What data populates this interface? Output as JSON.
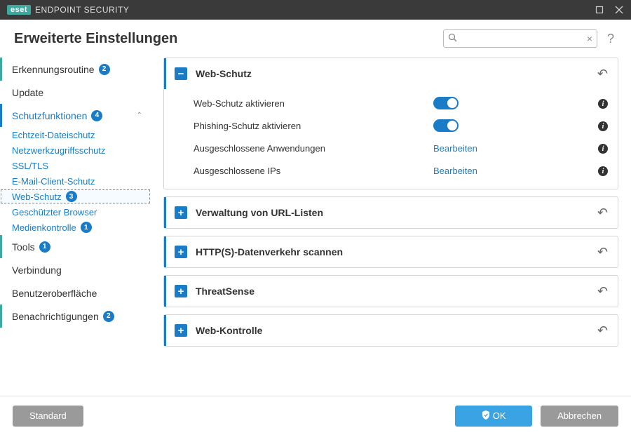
{
  "titlebar": {
    "brand": "eset",
    "product": "ENDPOINT SECURITY"
  },
  "page_title": "Erweiterte Einstellungen",
  "search": {
    "placeholder": ""
  },
  "sidebar": {
    "items": [
      {
        "label": "Erkennungsroutine",
        "badge": "2"
      },
      {
        "label": "Update"
      },
      {
        "label": "Schutzfunktionen",
        "badge": "4"
      },
      {
        "label": "Tools",
        "badge": "1"
      },
      {
        "label": "Verbindung"
      },
      {
        "label": "Benutzeroberfläche"
      },
      {
        "label": "Benachrichtigungen",
        "badge": "2"
      }
    ],
    "sub": [
      {
        "label": "Echtzeit-Dateischutz"
      },
      {
        "label": "Netzwerkzugriffsschutz"
      },
      {
        "label": "SSL/TLS"
      },
      {
        "label": "E-Mail-Client-Schutz"
      },
      {
        "label": "Web-Schutz",
        "badge": "3"
      },
      {
        "label": "Geschützter Browser"
      },
      {
        "label": "Medienkontrolle",
        "badge": "1"
      }
    ]
  },
  "panels": [
    {
      "title": "Web-Schutz",
      "rows": [
        {
          "label": "Web-Schutz aktivieren",
          "control": "toggle"
        },
        {
          "label": "Phishing-Schutz aktivieren",
          "control": "toggle"
        },
        {
          "label": "Ausgeschlossene Anwendungen",
          "control": "link",
          "action": "Bearbeiten"
        },
        {
          "label": "Ausgeschlossene IPs",
          "control": "link",
          "action": "Bearbeiten"
        }
      ]
    },
    {
      "title": "Verwaltung von URL-Listen"
    },
    {
      "title": "HTTP(S)-Datenverkehr scannen"
    },
    {
      "title": "ThreatSense"
    },
    {
      "title": "Web-Kontrolle"
    }
  ],
  "footer": {
    "default": "Standard",
    "ok": "OK",
    "cancel": "Abbrechen"
  }
}
